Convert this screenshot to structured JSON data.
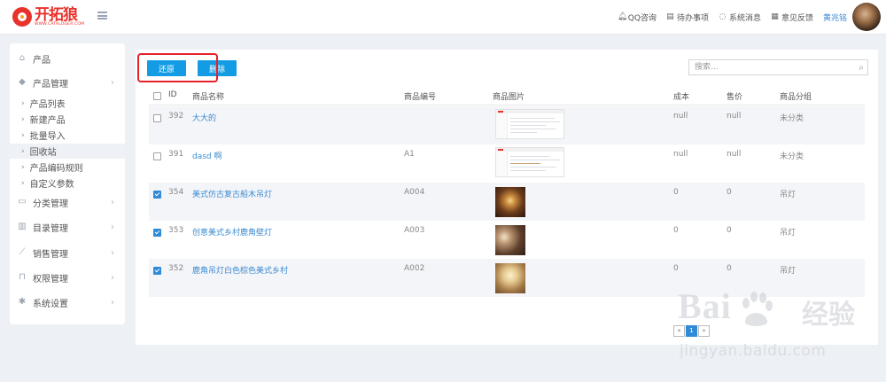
{
  "app": {
    "logo_text": "开拓狼",
    "logo_sub": "WWW.CATALOGER.COM"
  },
  "topbar": {
    "links": [
      {
        "icon": "bell-icon",
        "label": "QQ咨询"
      },
      {
        "icon": "clipboard-icon",
        "label": "待办事项"
      },
      {
        "icon": "chat-icon",
        "label": "系统消息"
      },
      {
        "icon": "calendar-icon",
        "label": "意见反馈"
      }
    ],
    "user_name": "黄兆铭"
  },
  "sidebar": {
    "items": [
      {
        "label": "产品",
        "icon": "home-icon"
      },
      {
        "label": "产品管理",
        "icon": "tag-icon"
      },
      {
        "label": "分类管理",
        "icon": "folder-icon"
      },
      {
        "label": "目录管理",
        "icon": "document-icon"
      },
      {
        "label": "销售管理",
        "icon": "chart-icon"
      },
      {
        "label": "权限管理",
        "icon": "lock-icon"
      },
      {
        "label": "系统设置",
        "icon": "gear-icon"
      }
    ],
    "sub_items": [
      "产品列表",
      "新建产品",
      "批量导入",
      "回收站",
      "产品编码规则",
      "自定义参数"
    ],
    "active_sub": "回收站"
  },
  "toolbar": {
    "restore_label": "还原",
    "delete_label": "删除",
    "search_placeholder": "搜索..."
  },
  "table": {
    "headers": {
      "id": "ID",
      "name": "商品名称",
      "code": "商品编号",
      "image": "商品图片",
      "cost": "成本",
      "price": "售价",
      "category": "商品分组"
    },
    "rows": [
      {
        "checked": false,
        "id": "392",
        "name": "大大的",
        "code": "",
        "image": "screenshot",
        "cost": "null",
        "price": "null",
        "category": "未分类"
      },
      {
        "checked": false,
        "id": "391",
        "name": "dasd 啊",
        "code": "A1",
        "image": "screenshot",
        "cost": "null",
        "price": "null",
        "category": "未分类"
      },
      {
        "checked": true,
        "id": "354",
        "name": "美式仿古复古船木吊灯",
        "code": "A004",
        "image": "photo-dark",
        "cost": "0",
        "price": "0",
        "category": "吊灯"
      },
      {
        "checked": true,
        "id": "353",
        "name": "创意美式乡村鹿角壁灯",
        "code": "A003",
        "image": "photo-wall",
        "cost": "0",
        "price": "0",
        "category": "吊灯"
      },
      {
        "checked": true,
        "id": "352",
        "name": "鹿角吊灯白色棕色美式乡村",
        "code": "A002",
        "image": "photo-light",
        "cost": "0",
        "price": "0",
        "category": "吊灯"
      }
    ]
  },
  "pagination": {
    "prev": "«",
    "current": "1",
    "next": "»"
  },
  "watermark": {
    "brand": "Bai",
    "brand_cn": "经验",
    "url": "jingyan.baidu.com"
  }
}
